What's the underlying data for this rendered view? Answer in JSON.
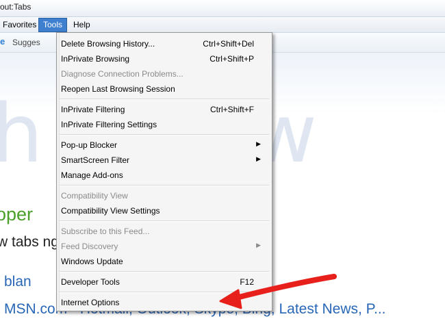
{
  "window": {
    "title": "out:Tabs"
  },
  "menubar": {
    "items": [
      "Favorites",
      "Tools",
      "Help"
    ]
  },
  "favorites_bar": {
    "suggested_label": "Sugges"
  },
  "page": {
    "big_watermark": "h    you w",
    "green_heading": "oper",
    "black_line": "w tabs               ng Internet Explorer.",
    "link1": "blan",
    "link2": "MSN.com - Hotmail, Outlook, Skype, Bing, Latest News, P..."
  },
  "tools_menu": {
    "groups": [
      [
        {
          "label": "Delete Browsing History...",
          "shortcut": "Ctrl+Shift+Del",
          "disabled": false,
          "submenu": false
        },
        {
          "label": "InPrivate Browsing",
          "shortcut": "Ctrl+Shift+P",
          "disabled": false,
          "submenu": false
        },
        {
          "label": "Diagnose Connection Problems...",
          "shortcut": "",
          "disabled": true,
          "submenu": false
        },
        {
          "label": "Reopen Last Browsing Session",
          "shortcut": "",
          "disabled": false,
          "submenu": false
        }
      ],
      [
        {
          "label": "InPrivate Filtering",
          "shortcut": "Ctrl+Shift+F",
          "disabled": false,
          "submenu": false
        },
        {
          "label": "InPrivate Filtering Settings",
          "shortcut": "",
          "disabled": false,
          "submenu": false
        }
      ],
      [
        {
          "label": "Pop-up Blocker",
          "shortcut": "",
          "disabled": false,
          "submenu": true
        },
        {
          "label": "SmartScreen Filter",
          "shortcut": "",
          "disabled": false,
          "submenu": true
        },
        {
          "label": "Manage Add-ons",
          "shortcut": "",
          "disabled": false,
          "submenu": false
        }
      ],
      [
        {
          "label": "Compatibility View",
          "shortcut": "",
          "disabled": true,
          "submenu": false
        },
        {
          "label": "Compatibility View Settings",
          "shortcut": "",
          "disabled": false,
          "submenu": false
        }
      ],
      [
        {
          "label": "Subscribe to this Feed...",
          "shortcut": "",
          "disabled": true,
          "submenu": false
        },
        {
          "label": "Feed Discovery",
          "shortcut": "",
          "disabled": true,
          "submenu": true
        },
        {
          "label": "Windows Update",
          "shortcut": "",
          "disabled": false,
          "submenu": false
        }
      ],
      [
        {
          "label": "Developer Tools",
          "shortcut": "F12",
          "disabled": false,
          "submenu": false
        }
      ],
      [
        {
          "label": "Internet Options",
          "shortcut": "",
          "disabled": false,
          "submenu": false
        }
      ]
    ]
  },
  "annotation": {
    "arrow_color": "#e8201c"
  }
}
